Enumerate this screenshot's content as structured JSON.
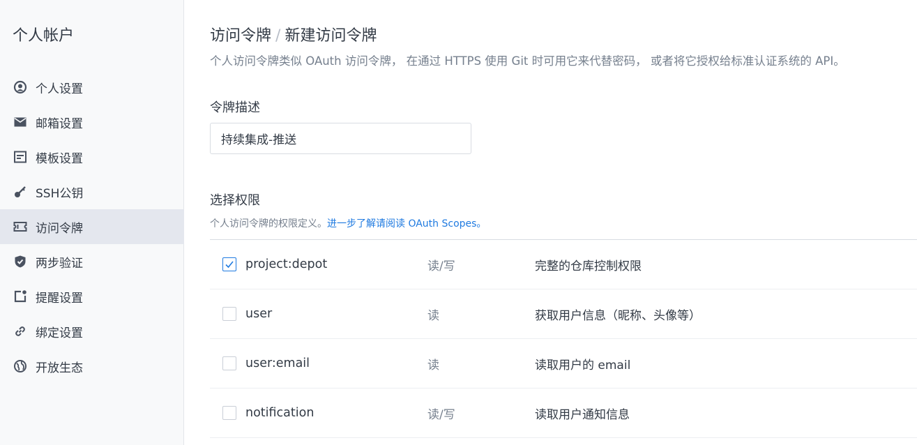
{
  "sidebar": {
    "title": "个人帐户",
    "items": [
      {
        "label": "个人设置",
        "icon": "user-circle-icon",
        "active": false
      },
      {
        "label": "邮箱设置",
        "icon": "mail-icon",
        "active": false
      },
      {
        "label": "模板设置",
        "icon": "template-icon",
        "active": false
      },
      {
        "label": "SSH公钥",
        "icon": "key-icon",
        "active": false
      },
      {
        "label": "访问令牌",
        "icon": "ticket-icon",
        "active": true
      },
      {
        "label": "两步验证",
        "icon": "shield-icon",
        "active": false
      },
      {
        "label": "提醒设置",
        "icon": "notification-icon",
        "active": false
      },
      {
        "label": "绑定设置",
        "icon": "link-icon",
        "active": false
      },
      {
        "label": "开放生态",
        "icon": "globe-icon",
        "active": false
      }
    ]
  },
  "main": {
    "breadcrumb": {
      "parent": "访问令牌",
      "separator": "/",
      "current": "新建访问令牌"
    },
    "description": "个人访问令牌类似 OAuth 访问令牌， 在通过 HTTPS 使用 Git 时可用它来代替密码， 或者将它授权给标准认证系统的 API。",
    "token_label": "令牌描述",
    "token_value": "持续集成-推送",
    "permissions_label": "选择权限",
    "permissions_hint": "个人访问令牌的权限定义。",
    "permissions_link": "进一步了解请阅读 OAuth Scopes。",
    "scopes": [
      {
        "name": "project:depot",
        "access": "读/写",
        "desc": "完整的仓库控制权限",
        "checked": true
      },
      {
        "name": "user",
        "access": "读",
        "desc": "获取用户信息（昵称、头像等）",
        "checked": false
      },
      {
        "name": "user:email",
        "access": "读",
        "desc": "读取用户的 email",
        "checked": false
      },
      {
        "name": "notification",
        "access": "读/写",
        "desc": "读取用户通知信息",
        "checked": false
      }
    ]
  },
  "colors": {
    "accent": "#1f7ae0",
    "active_bg": "#e4e7ee",
    "sidebar_bg": "#f8f9fa"
  }
}
